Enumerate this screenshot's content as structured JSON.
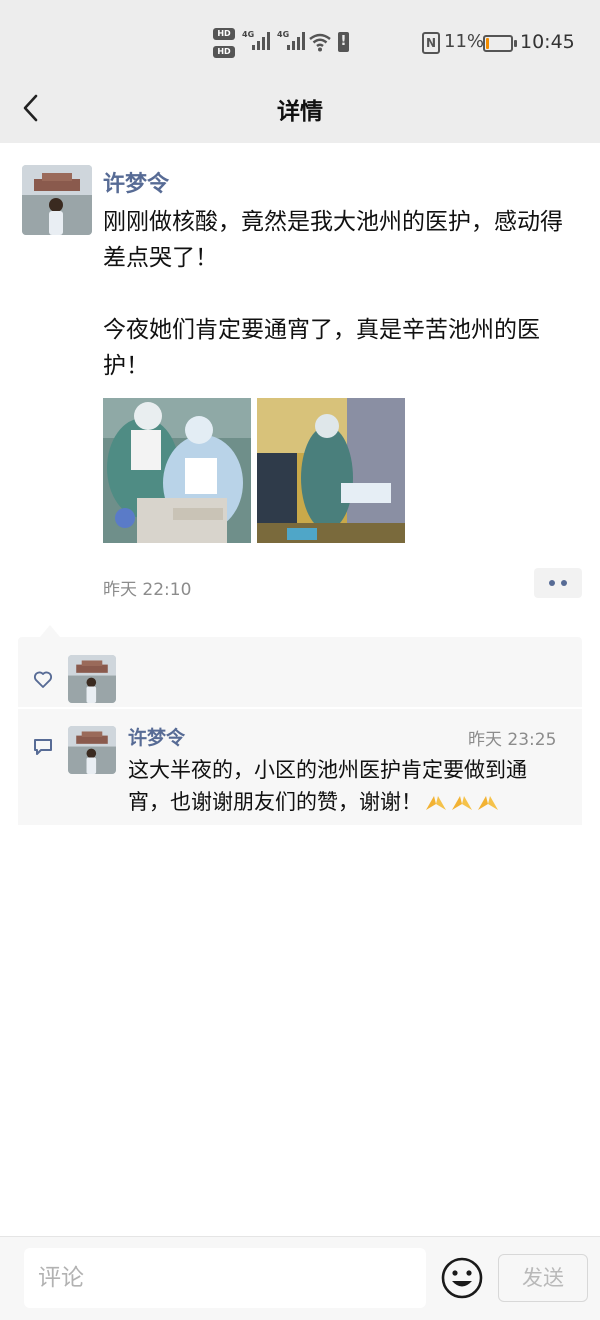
{
  "status_bar": {
    "hd1": "HD",
    "hd2": "HD",
    "net1": "4G",
    "net2": "4G",
    "nfc": "N",
    "battery_percent": "11%",
    "battery_level": 0.11,
    "time": "10:45"
  },
  "header": {
    "title": "详情"
  },
  "post": {
    "author": "许梦令",
    "paragraphs": [
      "刚刚做核酸，竟然是我大池州的医护，感动得差点哭了！",
      "今夜她们肯定要通宵了，真是辛苦池州的医护！"
    ],
    "time": "昨天 22:10"
  },
  "comments": [
    {
      "author": "许梦令",
      "time": "昨天 23:25",
      "text": "这大半夜的，小区的池州医护肯定要做到通宵，也谢谢朋友们的赞，谢谢！"
    }
  ],
  "bottom_bar": {
    "placeholder": "评论",
    "send_label": "发送"
  },
  "icons": {
    "back": "back-arrow-icon",
    "more": "more-dots-icon",
    "like": "heart-icon",
    "comment": "comment-icon",
    "emoji": "smiley-icon",
    "pray": "folded-hands-emoji"
  },
  "colors": {
    "link": "#576b95",
    "background_gray": "#ededed",
    "panel": "#f7f7f7",
    "battery_low": "#f28c00"
  }
}
